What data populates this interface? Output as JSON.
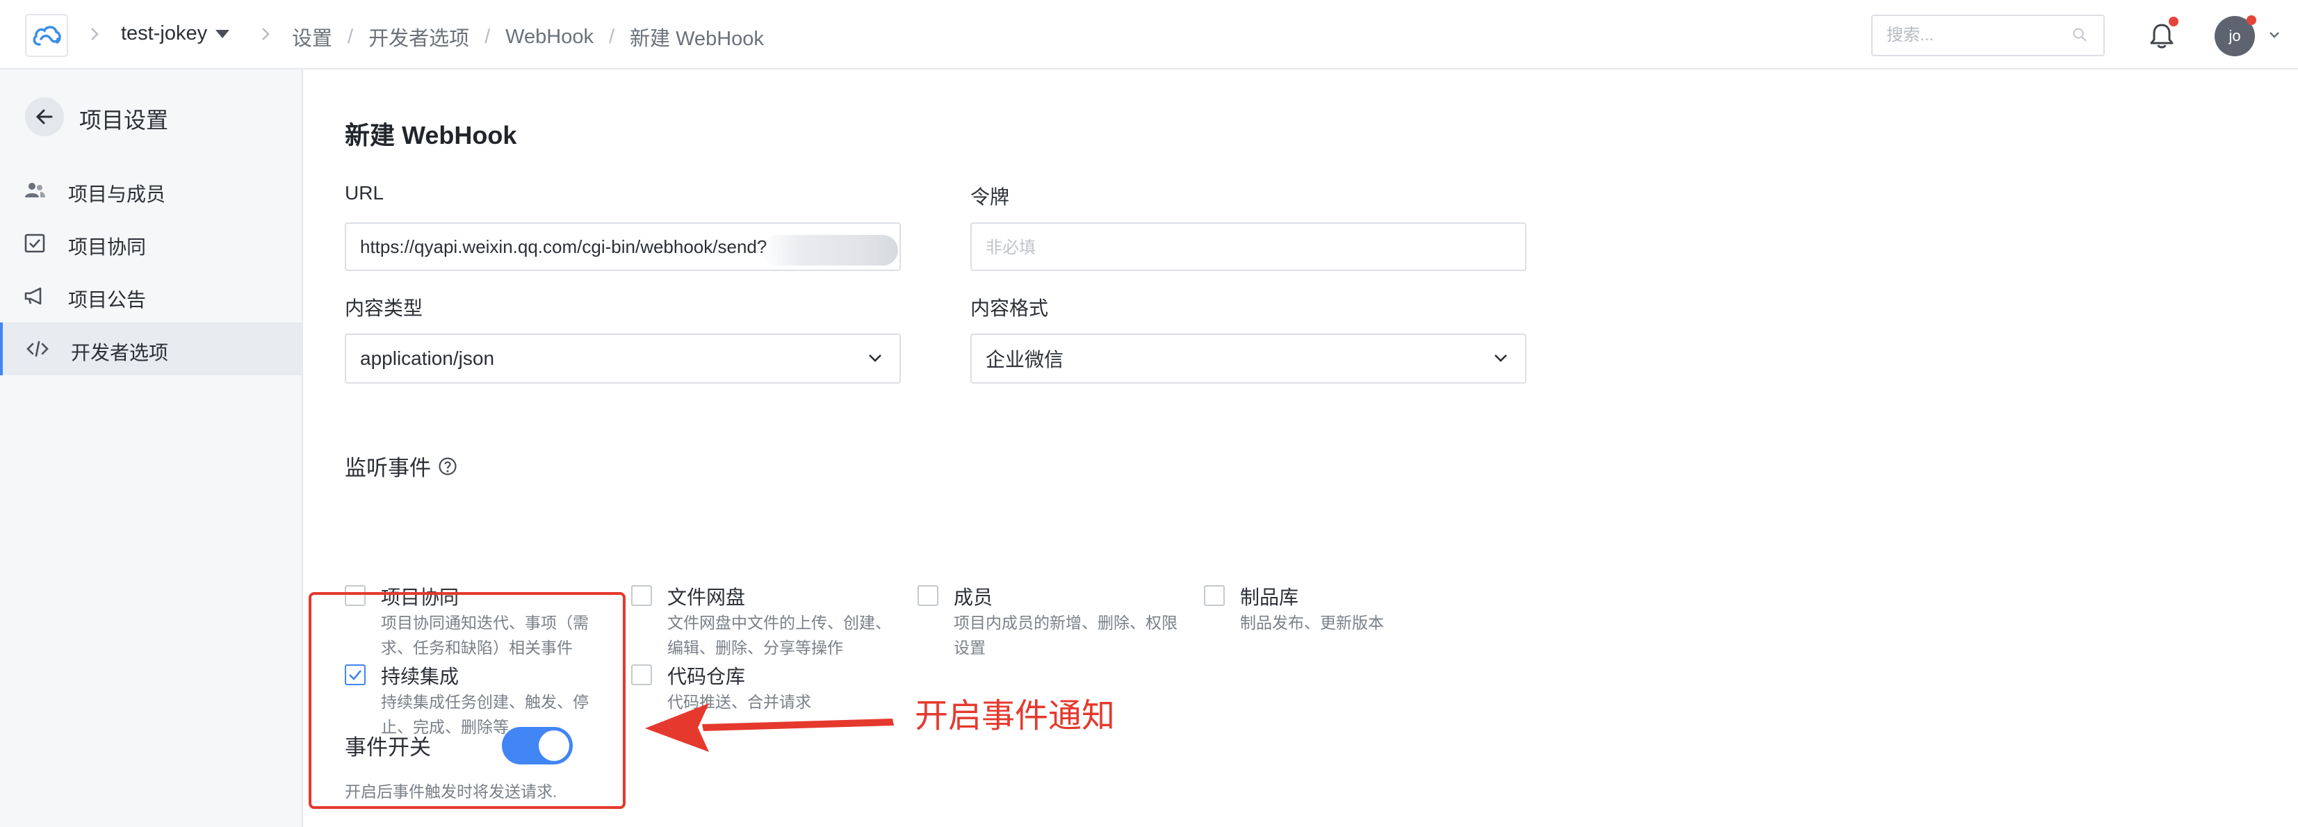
{
  "header": {
    "project": "test-jokey",
    "breadcrumb": [
      "设置",
      "开发者选项",
      "WebHook",
      "新建 WebHook"
    ],
    "search_placeholder": "搜索...",
    "avatar": "jo"
  },
  "sidebar": {
    "title": "项目设置",
    "items": [
      {
        "label": "项目与成员",
        "icon": "members-icon"
      },
      {
        "label": "项目协同",
        "icon": "checkbox-board-icon"
      },
      {
        "label": "项目公告",
        "icon": "megaphone-icon"
      },
      {
        "label": "开发者选项",
        "icon": "code-icon",
        "active": true
      }
    ]
  },
  "form": {
    "title": "新建 WebHook",
    "url_label": "URL",
    "url_value": "https://qyapi.weixin.qq.com/cgi-bin/webhook/send?",
    "token_label": "令牌",
    "token_placeholder": "非必填",
    "content_type_label": "内容类型",
    "content_type_value": "application/json",
    "content_format_label": "内容格式",
    "content_format_value": "企业微信"
  },
  "events": {
    "title": "监听事件",
    "items": [
      {
        "title": "项目协同",
        "desc": [
          "项目协同通知迭代、事项（需",
          "求、任务和缺陷）相关事件"
        ],
        "checked": false
      },
      {
        "title": "文件网盘",
        "desc": [
          "文件网盘中文件的上传、创建、",
          "编辑、删除、分享等操作"
        ],
        "checked": false
      },
      {
        "title": "成员",
        "desc": [
          "项目内成员的新增、删除、权限",
          "设置"
        ],
        "checked": false
      },
      {
        "title": "制品库",
        "desc": [
          "制品发布、更新版本"
        ],
        "checked": false
      },
      {
        "title": "持续集成",
        "desc": [
          "持续集成任务创建、触发、停",
          "止、完成、删除等"
        ],
        "checked": true
      },
      {
        "title": "代码仓库",
        "desc": [
          "代码推送、合并请求"
        ],
        "checked": false
      }
    ]
  },
  "switch": {
    "label": "事件开关",
    "desc": "开启后事件触发时将发送请求.",
    "on": true
  },
  "annotation": {
    "text": "开启事件通知"
  },
  "colors": {
    "accent": "#4285f4",
    "annotation": "#e5392e",
    "notification_dot": "#e5443a"
  }
}
